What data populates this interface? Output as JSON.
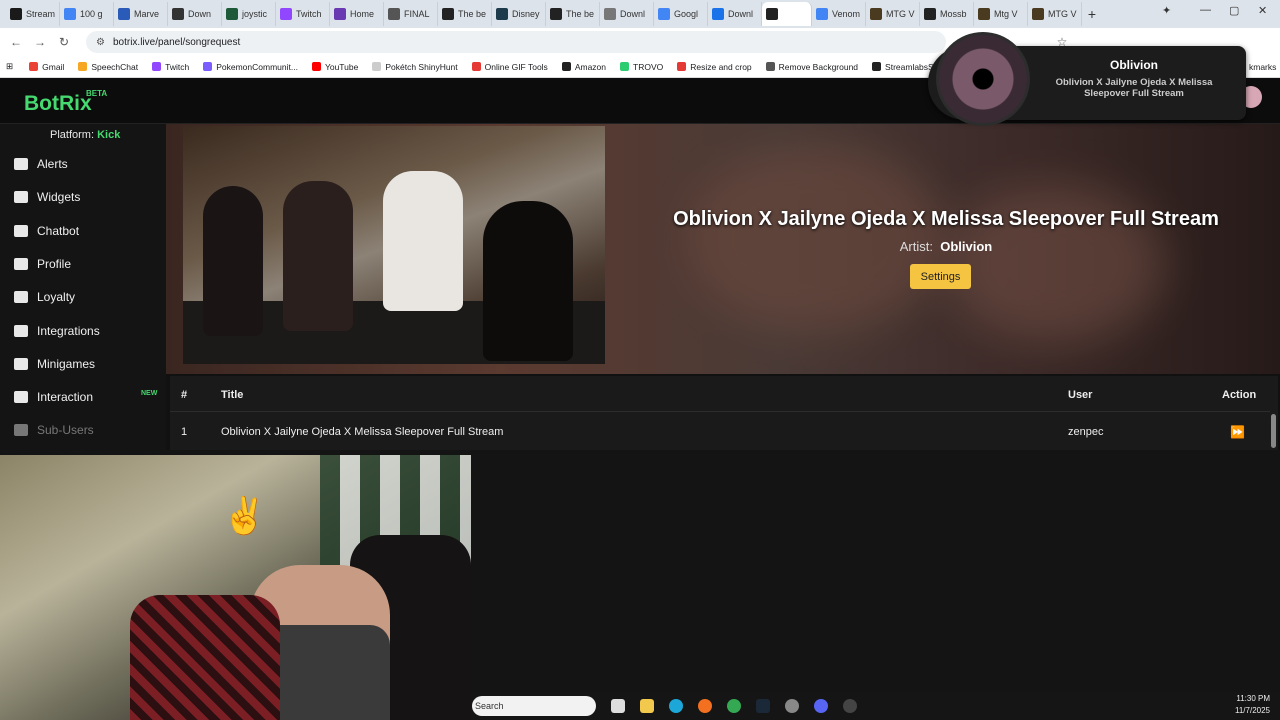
{
  "browser": {
    "tabs": [
      "Stream",
      "100 g",
      "Marve",
      "Down",
      "joystic",
      "Twitch",
      "Home",
      "FINAL",
      "The be",
      "Disney",
      "The be",
      "Downl",
      "Googl",
      "Downl",
      "",
      "Venom",
      "MTG V",
      "Mossb",
      "Mtg V",
      "MTG V"
    ],
    "active_tab_index": 14,
    "url": "botrix.live/panel/songrequest",
    "bookmarks": [
      "Gmail",
      "SpeechChat",
      "Twitch",
      "PokemonCommunit...",
      "YouTube",
      "Pokétch ShinyHunt",
      "Online GIF Tools",
      "Amazon",
      "TROVO",
      "Resize and crop",
      "Remove Background",
      "StreamlabsSupport"
    ],
    "bookmarks_tail": "kmarks",
    "tab_colors": [
      "#1a1a1a",
      "#4285f4",
      "#2b5bb9",
      "#333",
      "#1e5a3a",
      "#9146ff",
      "#6a3ab2",
      "#555",
      "#222",
      "#1d3b4a",
      "#222",
      "#777",
      "#4285f4",
      "#1a73e8",
      "#222",
      "#4285f4",
      "#4a3a20",
      "#222",
      "#4a3a20",
      "#4a3a20"
    ]
  },
  "app": {
    "logo": "BotRix",
    "beta": "BETA",
    "platform_label": "Platform:",
    "platform_value": "Kick",
    "nav": [
      {
        "label": "Alerts",
        "icon": "warning-icon"
      },
      {
        "label": "Widgets",
        "icon": "widgets-icon"
      },
      {
        "label": "Chatbot",
        "icon": "robot-icon"
      },
      {
        "label": "Profile",
        "icon": "id-card-icon"
      },
      {
        "label": "Loyalty",
        "icon": "trophy-icon"
      },
      {
        "label": "Integrations",
        "icon": "chat-icon"
      },
      {
        "label": "Minigames",
        "icon": "gamepad-icon"
      },
      {
        "label": "Interaction",
        "icon": "music-icon"
      },
      {
        "label": "Sub-Users",
        "icon": "users-icon"
      }
    ],
    "new_badge": "NEW"
  },
  "player": {
    "title": "Oblivion X Jailyne Ojeda X Melissa Sleepover Full Stream",
    "artist_label": "Artist:",
    "artist": "Oblivion",
    "settings_label": "Settings"
  },
  "queue": {
    "headers": {
      "num": "#",
      "title": "Title",
      "user": "User",
      "action": "Action"
    },
    "rows": [
      {
        "num": "1",
        "title": "Oblivion X Jailyne Ojeda X Melissa Sleepover Full Stream",
        "user": "zenpec"
      }
    ]
  },
  "now_playing": {
    "artist": "Oblivion",
    "title": "Oblivion X Jailyne Ojeda X Melissa Sleepover Full Stream"
  },
  "taskbar": {
    "search_placeholder": "Search",
    "time": "11:30 PM",
    "date": "11/7/2025"
  }
}
